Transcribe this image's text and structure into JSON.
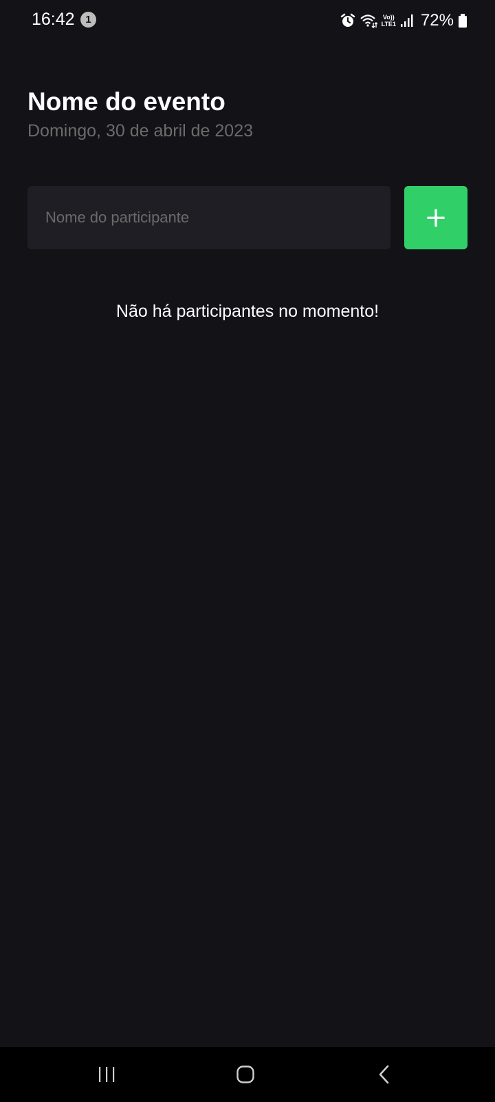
{
  "status_bar": {
    "time": "16:42",
    "notification_count": "1",
    "network_label_top": "Vo))",
    "network_label_bottom": "LTE1",
    "battery_percent": "72%",
    "icons": [
      "alarm-icon",
      "wifi-icon",
      "volte-icon",
      "signal-icon",
      "battery-icon"
    ]
  },
  "header": {
    "title": "Nome do evento",
    "date": "Domingo, 30 de abril de 2023"
  },
  "form": {
    "input_placeholder": "Nome do participante",
    "input_value": "",
    "add_button_label": "+"
  },
  "empty_state": {
    "message": "Não há participantes no momento!"
  },
  "navigation_bar": {
    "buttons": [
      "recent-apps-icon",
      "home-icon",
      "back-icon"
    ]
  },
  "colors": {
    "background": "#131216",
    "input_background": "#1f1e25",
    "accent": "#31cf67",
    "muted_text": "#6b6b6b",
    "text": "#fdfcfe"
  }
}
